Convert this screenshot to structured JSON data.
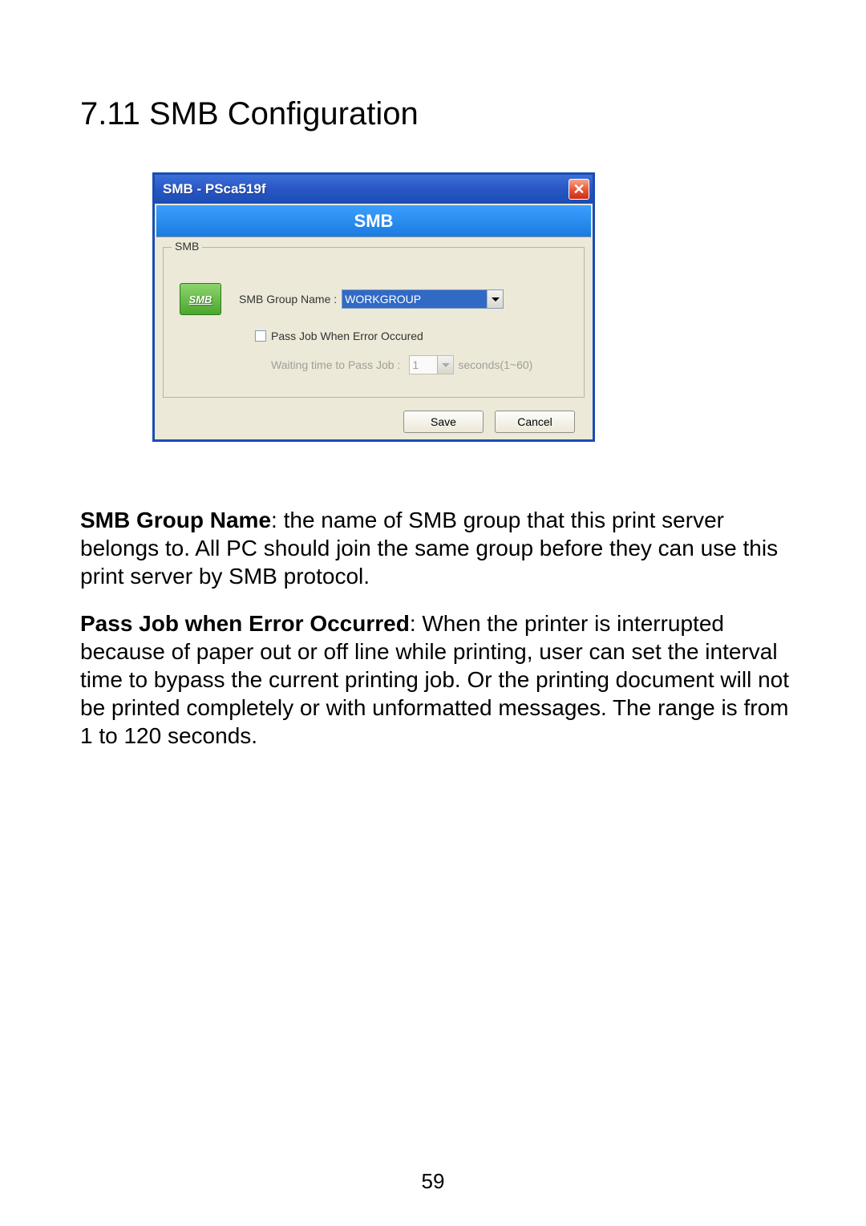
{
  "heading": "7.11   SMB Configuration",
  "dialog": {
    "title": "SMB - PSca519f",
    "banner": "SMB",
    "legend": "SMB",
    "icon_label": "SMB",
    "group_name_label": "SMB Group Name :",
    "group_name_value": "WORKGROUP",
    "checkbox_label": "Pass Job When Error Occured",
    "waiting_label": "Waiting time to Pass Job :",
    "waiting_value": "1",
    "waiting_suffix": "seconds(1~60)",
    "save": "Save",
    "cancel": "Cancel"
  },
  "para1": {
    "bold": "SMB Group Name",
    "rest": ": the name of SMB group that this print server belongs to. All PC should join the same group before they can use this print server by SMB protocol."
  },
  "para2": {
    "bold": "Pass Job when Error Occurred",
    "rest": ": When the printer is interrupted because of paper out or off line while printing, user can set the interval time to bypass the current printing job. Or the printing document will not be printed completely or with unformatted messages. The range is from 1 to 120 seconds."
  },
  "page_number": "59"
}
